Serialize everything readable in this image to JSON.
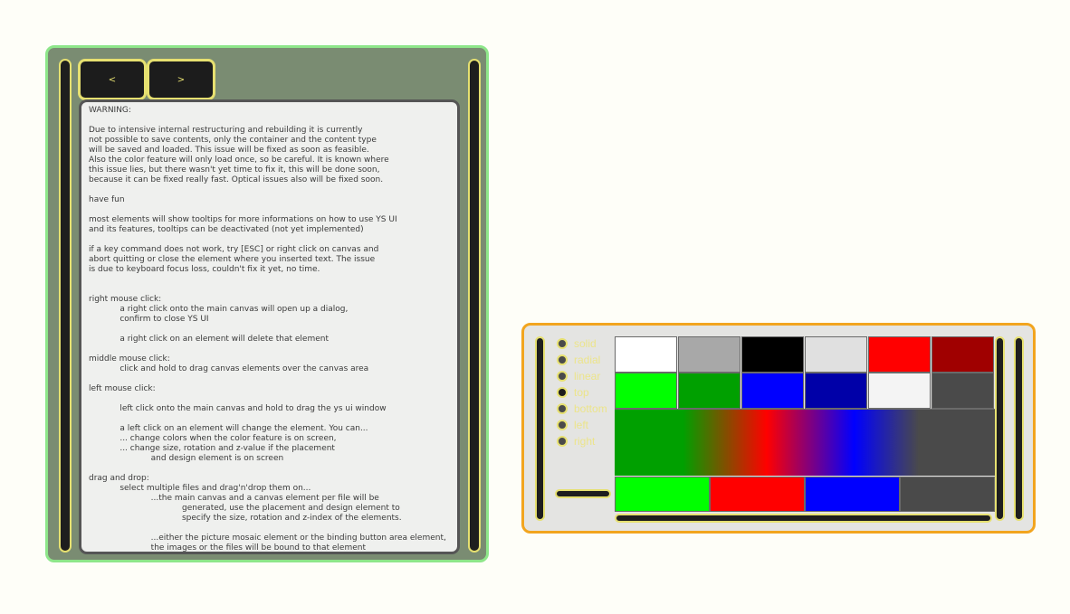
{
  "nav": {
    "prev_label": "<",
    "next_label": ">"
  },
  "info_lines": [
    "WARNING:",
    "",
    "Due to intensive internal restructuring and rebuilding it is currently",
    "not possible to save contents, only the container and the content type",
    "will be saved and loaded. This issue will be fixed as soon as feasible.",
    "Also the color feature will only load once, so be careful. It is known where",
    "this issue lies, but there wasn't yet time to fix it, this will be done soon,",
    "because it can be fixed really fast. Optical issues also will be fixed soon.",
    "",
    "have fun",
    "",
    "most elements will show tooltips for more informations on how to use YS UI",
    "and its features, tooltips can be deactivated (not yet implemented)",
    "",
    "if a key command does not work, try [ESC] or right click on canvas and",
    "abort quitting or close the element where you inserted text. The issue",
    "is due to keyboard focus loss, couldn't fix it yet, no time.",
    "",
    "",
    "right mouse click:",
    "            a right click onto the main canvas will open up a dialog,",
    "            confirm to close YS UI",
    "",
    "            a right click on an element will delete that element",
    "",
    "middle mouse click:",
    "            click and hold to drag canvas elements over the canvas area",
    "",
    "left mouse click:",
    "",
    "            left click onto the main canvas and hold to drag the ys ui window",
    "",
    "            a left click on an element will change the element. You can...",
    "            ... change colors when the color feature is on screen,",
    "            ... change size, rotation and z-value if the placement",
    "                        and design element is on screen",
    "",
    "drag and drop:",
    "            select multiple files and drag'n'drop them on...",
    "                        ...the main canvas and a canvas element per file will be",
    "                                    generated, use the placement and design element to",
    "                                    specify the size, rotation and z-index of the elements.",
    "",
    "                        ...either the picture mosaic element or the binding button area element,",
    "                        the images or the files will be bound to that element"
  ],
  "gradient_modes": [
    {
      "label": "solid",
      "selected": false
    },
    {
      "label": "radial",
      "selected": false
    },
    {
      "label": "linear",
      "selected": false
    },
    {
      "label": "top",
      "selected": true
    },
    {
      "label": "bottom",
      "selected": false
    },
    {
      "label": "left",
      "selected": false
    },
    {
      "label": "right",
      "selected": false
    }
  ],
  "palette": [
    "#ffffff",
    "#a8a8a8",
    "#000000",
    "#e0e0e0",
    "#ff0000",
    "#a00000",
    "#00ff00",
    "#00a000",
    "#0000ff",
    "#0000a8",
    "#f4f4f4",
    "#4a4a4a"
  ],
  "gradient_stops": [
    "#00ff00",
    "#ff0000",
    "#0000ff",
    "#4a4a4a"
  ]
}
